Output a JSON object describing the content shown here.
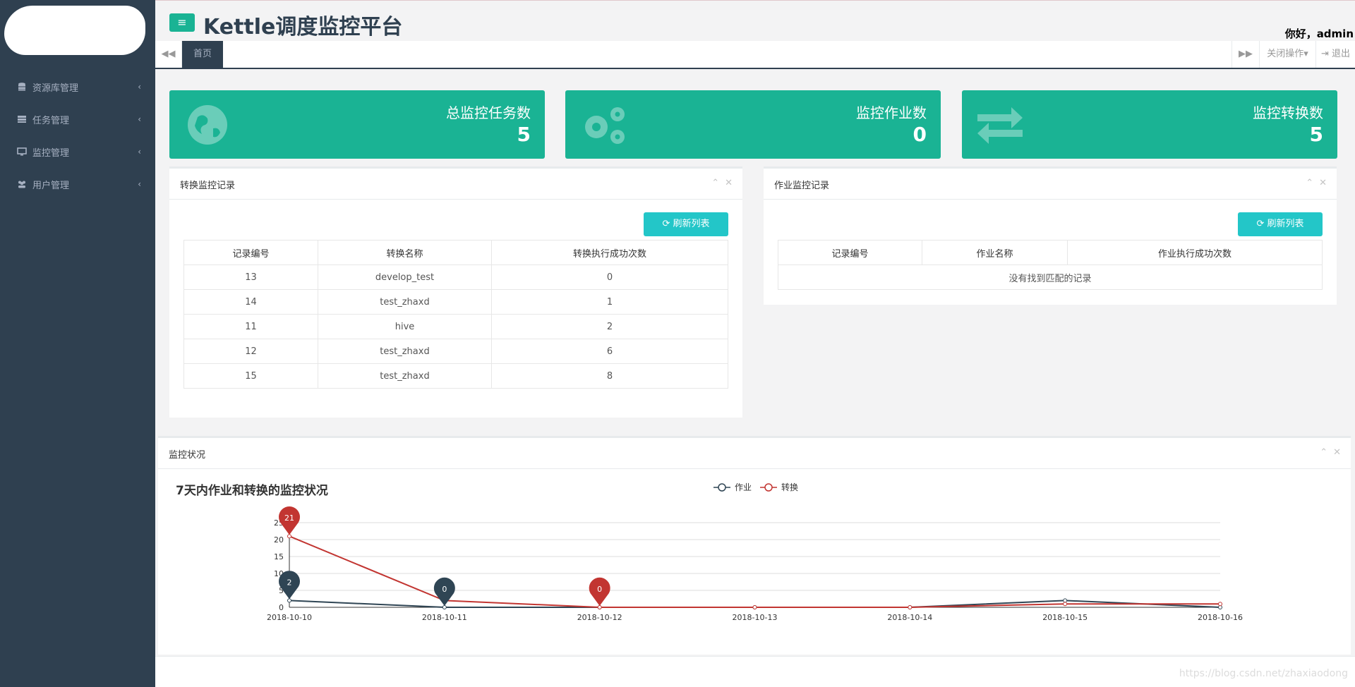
{
  "header": {
    "app_title": "Kettle调度监控平台",
    "greeting": "你好，admin",
    "menu_icon": "bars-icon"
  },
  "sidebar": {
    "items": [
      {
        "label": "资源库管理",
        "icon": "database-icon"
      },
      {
        "label": "任务管理",
        "icon": "tasks-icon"
      },
      {
        "label": "监控管理",
        "icon": "monitor-icon"
      },
      {
        "label": "用户管理",
        "icon": "users-icon"
      }
    ]
  },
  "tabbar": {
    "home_tab": "首页",
    "close_ops": "关闭操作",
    "logout": "退出"
  },
  "stats": [
    {
      "label": "总监控任务数",
      "value": "5",
      "icon": "globe-icon"
    },
    {
      "label": "监控作业数",
      "value": "0",
      "icon": "gears-icon"
    },
    {
      "label": "监控转换数",
      "value": "5",
      "icon": "exchange-icon"
    }
  ],
  "trans_panel": {
    "title": "转换监控记录",
    "refresh_label": "刷新列表",
    "columns": [
      "记录编号",
      "转换名称",
      "转换执行成功次数"
    ],
    "rows": [
      [
        "13",
        "develop_test",
        "0"
      ],
      [
        "14",
        "test_zhaxd",
        "1"
      ],
      [
        "11",
        "hive",
        "2"
      ],
      [
        "12",
        "test_zhaxd",
        "6"
      ],
      [
        "15",
        "test_zhaxd",
        "8"
      ]
    ]
  },
  "job_panel": {
    "title": "作业监控记录",
    "refresh_label": "刷新列表",
    "columns": [
      "记录编号",
      "作业名称",
      "作业执行成功次数"
    ],
    "empty_text": "没有找到匹配的记录"
  },
  "monitor_panel": {
    "title": "监控状况"
  },
  "chart_data": {
    "type": "line",
    "title": "7天内作业和转换的监控状况",
    "categories": [
      "2018-10-10",
      "2018-10-11",
      "2018-10-12",
      "2018-10-13",
      "2018-10-14",
      "2018-10-15",
      "2018-10-16"
    ],
    "yticks": [
      "0",
      "5",
      "10",
      "15",
      "20",
      "25"
    ],
    "ylim": [
      0,
      25
    ],
    "legend_position": "top-center",
    "grid": true,
    "series": [
      {
        "name": "作业",
        "color": "#2f4554",
        "values": [
          2,
          0,
          0,
          0,
          0,
          2,
          0
        ]
      },
      {
        "name": "转换",
        "color": "#c23531",
        "values": [
          21,
          2,
          0,
          0,
          0,
          1,
          1
        ]
      }
    ],
    "markers": [
      {
        "series": 1,
        "index": 0,
        "label": "21"
      },
      {
        "series": 0,
        "index": 0,
        "label": "2"
      },
      {
        "series": 0,
        "index": 1,
        "label": "0"
      },
      {
        "series": 1,
        "index": 2,
        "label": "0"
      }
    ]
  },
  "footer": {
    "watermark": "https://blog.csdn.net/zhaxiaodong"
  }
}
